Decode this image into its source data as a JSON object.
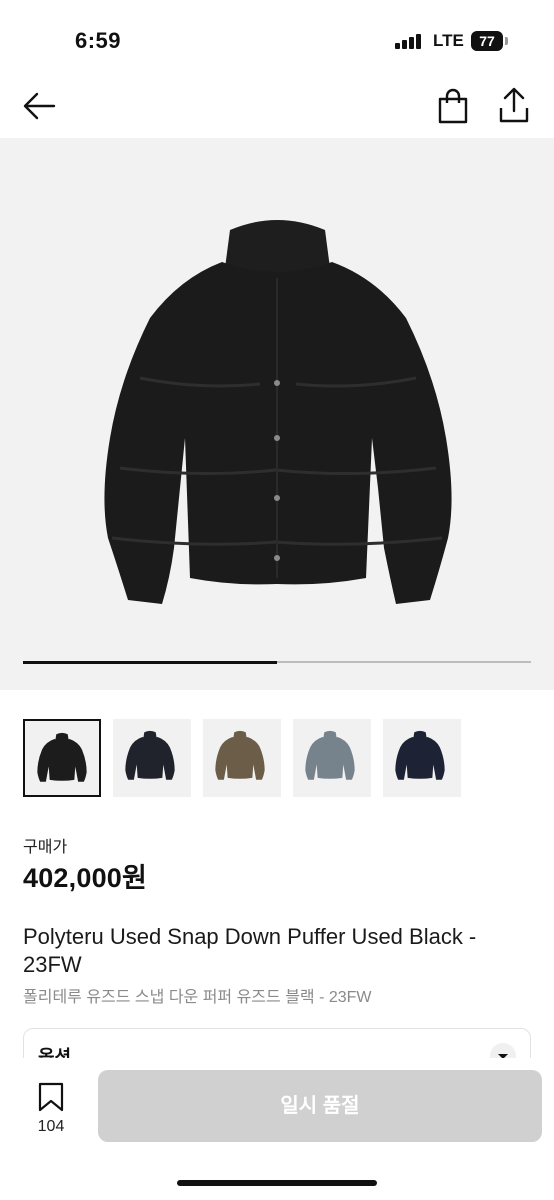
{
  "status_bar": {
    "time": "6:59",
    "network": "LTE",
    "battery": "77"
  },
  "nav": {
    "back_icon": "arrow-left-icon",
    "cart_icon": "shopping-bag-icon",
    "share_icon": "share-icon"
  },
  "gallery": {
    "progress": 0.5,
    "thumbnail_count": 5,
    "selected_index": 0,
    "thumbnail_colors": [
      "#1c1c1c",
      "#20232b",
      "#6b5d48",
      "#77838c",
      "#1d2234"
    ]
  },
  "product": {
    "price_label": "구매가",
    "price": "402,000원",
    "title_en": "Polyteru Used Snap Down Puffer Used Black - 23FW",
    "title_ko": "폴리테루 유즈드 스냅 다운 퍼퍼 유즈드 블랙 - 23FW"
  },
  "option": {
    "label": "옵션"
  },
  "bottom": {
    "wish_count": "104",
    "buy_button": "일시 품절"
  },
  "colors": {
    "soldout_button_bg": "#d0d0d0",
    "hero_bg": "#f2f2f2"
  }
}
